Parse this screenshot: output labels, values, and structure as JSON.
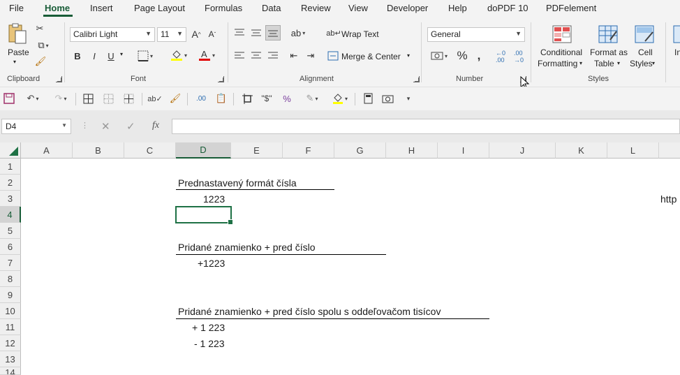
{
  "menu": {
    "tabs": [
      {
        "label": "File"
      },
      {
        "label": "Home"
      },
      {
        "label": "Insert"
      },
      {
        "label": "Page Layout"
      },
      {
        "label": "Formulas"
      },
      {
        "label": "Data"
      },
      {
        "label": "Review"
      },
      {
        "label": "View"
      },
      {
        "label": "Developer"
      },
      {
        "label": "Help"
      },
      {
        "label": "doPDF 10"
      },
      {
        "label": "PDFelement"
      }
    ],
    "active": "Home"
  },
  "ribbon": {
    "clipboard": {
      "label": "Clipboard",
      "paste": "Paste"
    },
    "font": {
      "label": "Font",
      "font_name": "Calibri Light",
      "font_size": "11",
      "bold": "B",
      "italic": "I",
      "underline": "U"
    },
    "alignment": {
      "label": "Alignment",
      "wrap_text": "Wrap Text",
      "merge_center": "Merge & Center"
    },
    "number": {
      "label": "Number",
      "format": "General"
    },
    "styles": {
      "label": "Styles",
      "conditional": {
        "line1": "Conditional",
        "line2": "Formatting"
      },
      "format_table": {
        "line1": "Format as",
        "line2": "Table"
      },
      "cell_styles": {
        "line1": "Cell",
        "line2": "Styles"
      },
      "cut_off": "In"
    }
  },
  "formula_bar": {
    "name_box": "D4",
    "fx": "fx",
    "formula": ""
  },
  "columns": [
    "A",
    "B",
    "C",
    "D",
    "E",
    "F",
    "G",
    "H",
    "I",
    "J",
    "K",
    "L"
  ],
  "selected_column": "D",
  "rows": [
    "1",
    "2",
    "3",
    "4",
    "5",
    "6",
    "7",
    "8",
    "9",
    "10",
    "11",
    "12",
    "13",
    "14"
  ],
  "selected_row": "4",
  "cells": {
    "d2": "Prednastavený formát čísla",
    "d3": "1223",
    "d6": "Pridané znamienko + pred číslo",
    "d7": "+1223",
    "d10": "Pridané znamienko + pred číslo spolu s oddeľovačom tisícov",
    "d11": "+ 1 223",
    "d12": "- 1 223",
    "l3": "http"
  },
  "colors": {
    "accent": "#185c37",
    "selection": "#1e7145",
    "ribbon_bg": "#f3f3f3"
  }
}
